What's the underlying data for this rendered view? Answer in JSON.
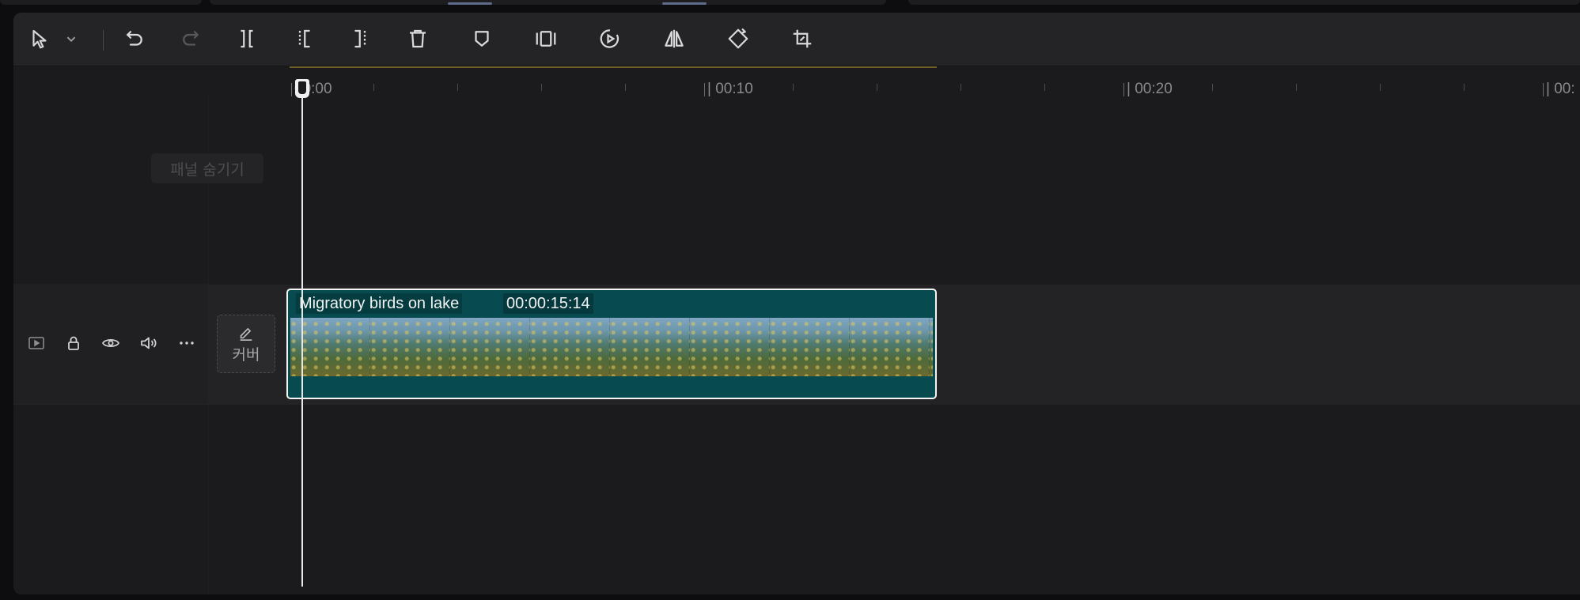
{
  "toolbar": {
    "tools": [
      {
        "name": "select-tool-icon"
      },
      {
        "name": "select-dropdown-icon"
      },
      {
        "name": "undo-icon"
      },
      {
        "name": "redo-icon",
        "disabled": true
      },
      {
        "name": "split-icon"
      },
      {
        "name": "trim-start-icon"
      },
      {
        "name": "trim-end-icon"
      },
      {
        "name": "delete-icon"
      },
      {
        "name": "marker-icon"
      },
      {
        "name": "freeze-frame-icon"
      },
      {
        "name": "speed-icon"
      },
      {
        "name": "mirror-icon"
      },
      {
        "name": "rotate-icon"
      },
      {
        "name": "crop-icon"
      }
    ]
  },
  "ruler": {
    "labels": [
      "00:00",
      "| 00:10",
      "| 00:20",
      "| 00:"
    ]
  },
  "panel": {
    "hide_label": "패널 숨기기"
  },
  "track": {
    "icons": [
      "video-track-icon",
      "lock-icon",
      "eye-icon",
      "volume-icon",
      "more-icon"
    ],
    "cover_label": "커버"
  },
  "clip": {
    "title": "Migratory birds on lake",
    "duration": "00:00:15:14",
    "thumbnail_count": 9
  },
  "colors": {
    "clip_bg": "#074a4f",
    "panel_bg": "#1b1b1d",
    "toolbar_bg": "#242427",
    "playhead": "#e8e8e8"
  }
}
